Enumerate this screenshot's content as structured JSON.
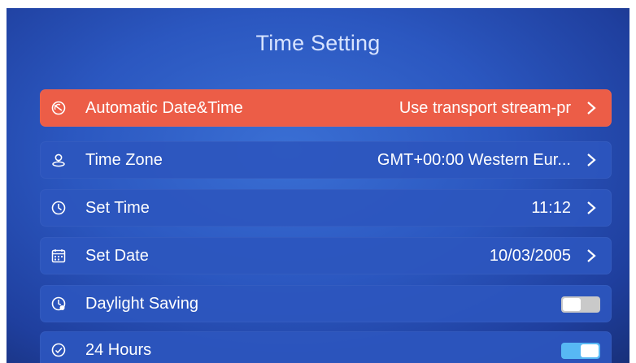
{
  "title": "Time Setting",
  "rows": [
    {
      "label": "Automatic Date&Time",
      "value": "Use transport stream-pr",
      "icon": "auto-time-icon"
    },
    {
      "label": "Time Zone",
      "value": "GMT+00:00 Western Eur...",
      "icon": "location-icon"
    },
    {
      "label": "Set Time",
      "value": "11:12",
      "icon": "clock-icon"
    },
    {
      "label": "Set Date",
      "value": "10/03/2005",
      "icon": "calendar-icon"
    },
    {
      "label": "Daylight Saving",
      "toggle": "off",
      "icon": "daylight-icon"
    },
    {
      "label": "24 Hours",
      "toggle": "on",
      "icon": "clock-24-icon"
    }
  ],
  "colors": {
    "background": "#2b57c0",
    "selected_row": "#ec5d47",
    "row": "#2c56be",
    "toggle_on": "#57b8f4",
    "toggle_off": "#c9c9c9"
  }
}
